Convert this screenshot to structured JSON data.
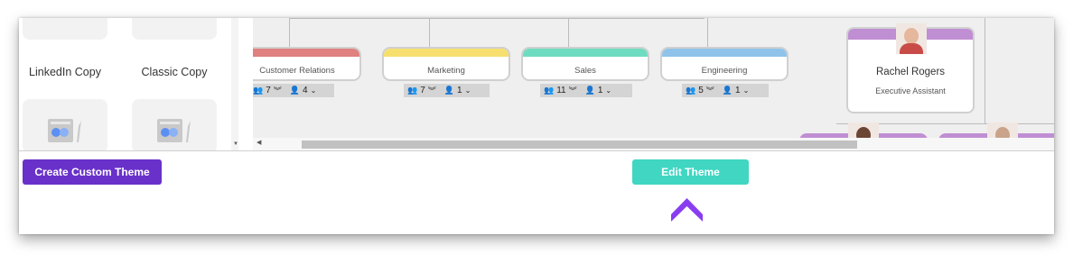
{
  "themes": {
    "items": [
      {
        "label": "LinkedIn Copy"
      },
      {
        "label": "Classic Copy"
      }
    ]
  },
  "chart": {
    "departments": [
      {
        "name": "Customer Relations",
        "band_color": "#e0817f",
        "team": "7",
        "people": "4"
      },
      {
        "name": "Marketing",
        "band_color": "#f6df6e",
        "team": "7",
        "people": "1"
      },
      {
        "name": "Sales",
        "band_color": "#6fdcc1",
        "team": "11",
        "people": "1"
      },
      {
        "name": "Engineering",
        "band_color": "#8fc3ea",
        "team": "5",
        "people": "1"
      }
    ],
    "person": {
      "name": "Rachel Rogers",
      "title": "Executive Assistant",
      "band_color": "#c08ed3"
    }
  },
  "actions": {
    "create_label": "Create Custom Theme",
    "edit_label": "Edit Theme"
  },
  "colors": {
    "create_button": "#6931c9",
    "edit_button": "#40d6c2",
    "pointer_arrow": "#8a3df0"
  },
  "icons": {
    "team": "group-icon",
    "people": "person-icon",
    "expand": "double-chevron-down-icon",
    "dropdown": "chevron-down-icon",
    "theme_preview": "theme-preview-icon"
  }
}
